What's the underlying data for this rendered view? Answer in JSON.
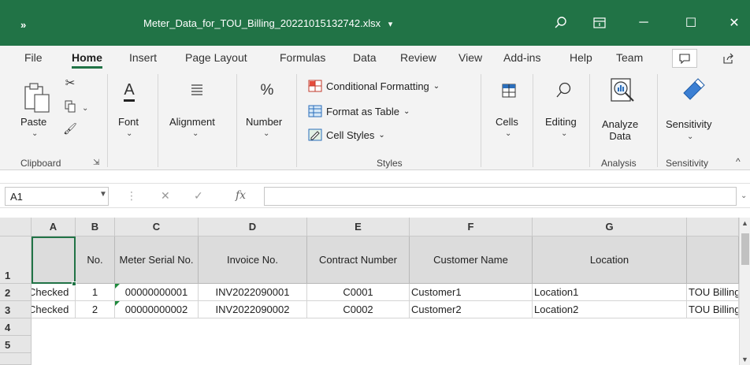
{
  "titlebar": {
    "qat": "»",
    "filename": "Meter_Data_for_TOU_Billing_20221015132742.xlsx",
    "filename_caret": "▾",
    "search_icon": "search-icon",
    "ribbon_display_icon": "ribbon-display-icon",
    "minimize": "─",
    "maximize": "☐",
    "close": "✕"
  },
  "menu": {
    "tabs": [
      "File",
      "Home",
      "Insert",
      "Page Layout",
      "Formulas",
      "Data",
      "Review",
      "View",
      "Add-ins",
      "Help",
      "Team"
    ],
    "active": "Home",
    "comment_button": "comment-icon",
    "share_button": "share-icon"
  },
  "ribbon": {
    "clipboard": {
      "paste": "Paste",
      "group": "Clipboard"
    },
    "font": {
      "label": "Font",
      "icon_letter": "A"
    },
    "alignment": {
      "label": "Alignment"
    },
    "number": {
      "label": "Number",
      "icon": "%"
    },
    "styles": {
      "conditional": "Conditional Formatting",
      "table": "Format as Table",
      "cell_styles": "Cell Styles",
      "group": "Styles"
    },
    "cells": {
      "label": "Cells"
    },
    "editing": {
      "label": "Editing"
    },
    "analysis": {
      "label_line1": "Analyze",
      "label_line2": "Data",
      "group": "Analysis"
    },
    "sensitivity": {
      "label": "Sensitivity",
      "group": "Sensitivity"
    },
    "dropdown_chevron": "⌄",
    "collapse": "^"
  },
  "formula_bar": {
    "name_box": "A1",
    "cancel": "✕",
    "enter": "✓",
    "fx": "fx",
    "value": ""
  },
  "sheet": {
    "columns": [
      "A",
      "B",
      "C",
      "D",
      "E",
      "F",
      "G",
      ""
    ],
    "rows": [
      "1",
      "2",
      "3",
      "4",
      "5"
    ],
    "header_row": [
      "",
      "No.",
      "Meter Serial No.",
      "Invoice No.",
      "Contract Number",
      "Customer Name",
      "Location",
      ""
    ],
    "data": [
      [
        "Checked",
        "1",
        "00000000001",
        "INV2022090001",
        "C0001",
        "Customer1",
        "Location1",
        "TOU Billing"
      ],
      [
        "Checked",
        "2",
        "00000000002",
        "INV2022090002",
        "C0002",
        "Customer2",
        "Location2",
        "TOU Billing"
      ]
    ],
    "selected_cell": "A1"
  },
  "colors": {
    "title_green": "#217346",
    "ribbon_bg": "#f3f3f3",
    "header_fill": "#dcdcdc"
  }
}
